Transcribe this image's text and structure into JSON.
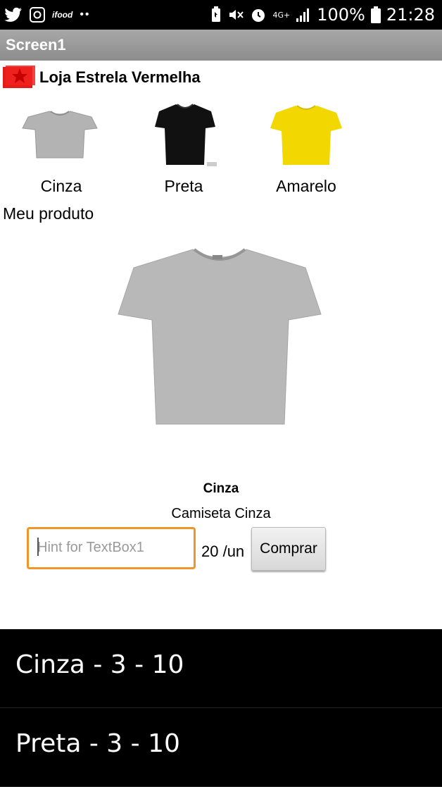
{
  "status_bar": {
    "left_icons": [
      "twitter-icon",
      "camera-app-icon",
      "ifood-icon",
      "more-dots-icon"
    ],
    "ifood_label": "ifood",
    "network": "4G+",
    "battery": "100%",
    "time": "21:28"
  },
  "app": {
    "screen_title": "Screen1",
    "store_name": "Loja Estrela Vermelha",
    "brand_color": "#e41b17"
  },
  "options": [
    {
      "label": "Cinza",
      "color": "#b3b3b3"
    },
    {
      "label": "Preta",
      "color": "#111111"
    },
    {
      "label": "Amarelo",
      "color": "#f2d800"
    }
  ],
  "product": {
    "section_label": "Meu produto",
    "name": "Cinza",
    "description": "Camiseta Cinza",
    "quantity_placeholder": "Hint for TextBox1",
    "price": "20 /un",
    "buy_label": "Comprar"
  },
  "cart_items": [
    {
      "label": "Cinza - 3 - 10"
    },
    {
      "label": "Preta - 3 - 10"
    }
  ]
}
